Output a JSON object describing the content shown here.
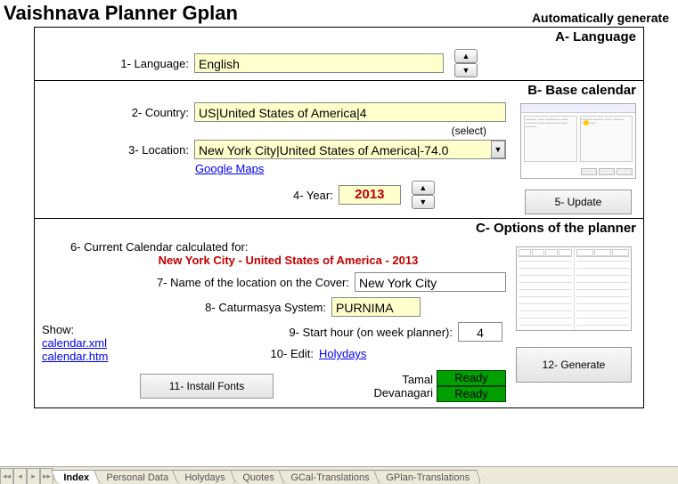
{
  "header": {
    "title": "Vaishnava Planner Gplan",
    "auto": "Automatically generate"
  },
  "secA": {
    "title": "A- Language",
    "lbl_language": "1- Language:",
    "language": "English"
  },
  "secB": {
    "title": "B- Base calendar",
    "lbl_country": "2- Country:",
    "country": "US|United States of America|4",
    "select_hint": "(select)",
    "lbl_location": "3- Location:",
    "location": "New York City|United States of America|-74.0",
    "gmaps": "Google Maps",
    "lbl_year": "4- Year:",
    "year": "2013",
    "update": "5- Update"
  },
  "secC": {
    "title": "C- Options of the planner",
    "lbl_current": "6- Current Calendar calculated for:",
    "current": "New York City - United States of America - 2013",
    "lbl_cover": "7- Name of the location on the Cover:",
    "cover": "New York City",
    "lbl_cat": "8- Caturmasya System:",
    "cat": "PURNIMA",
    "lbl_start": "9- Start hour (on week planner):",
    "start": "4",
    "lbl_edit": "10- Edit:",
    "edit_link": "Holydays",
    "show": "Show:",
    "show1": "calendar.xml",
    "show2": "calendar.htm",
    "install": "11- Install Fonts",
    "f1name": "Tamal",
    "f2name": "Devanagari",
    "f1state": "Ready",
    "f2state": "Ready",
    "generate": "12- Generate"
  },
  "tabs": [
    "Index",
    "Personal Data",
    "Holydays",
    "Quotes",
    "GCal-Translations",
    "GPlan-Translations"
  ]
}
